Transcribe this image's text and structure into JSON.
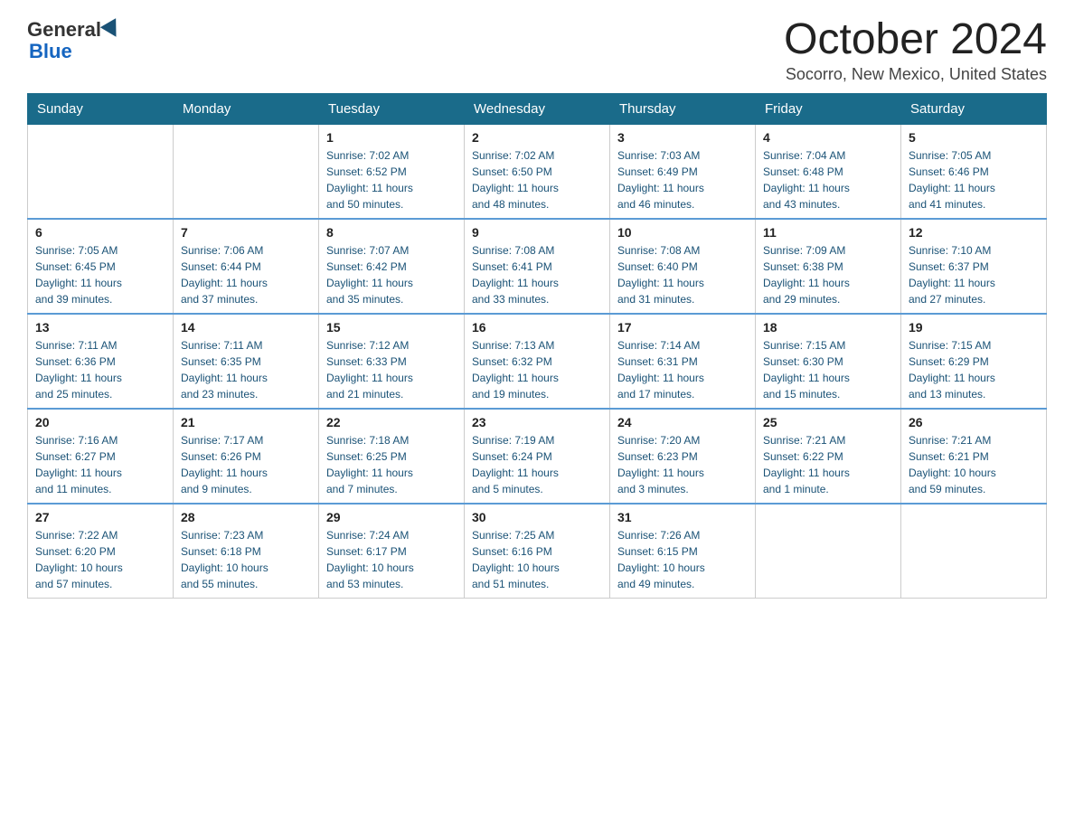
{
  "logo": {
    "general": "General",
    "blue": "Blue"
  },
  "header": {
    "month": "October 2024",
    "location": "Socorro, New Mexico, United States"
  },
  "weekdays": [
    "Sunday",
    "Monday",
    "Tuesday",
    "Wednesday",
    "Thursday",
    "Friday",
    "Saturday"
  ],
  "weeks": [
    [
      {
        "day": "",
        "info": ""
      },
      {
        "day": "",
        "info": ""
      },
      {
        "day": "1",
        "info": "Sunrise: 7:02 AM\nSunset: 6:52 PM\nDaylight: 11 hours\nand 50 minutes."
      },
      {
        "day": "2",
        "info": "Sunrise: 7:02 AM\nSunset: 6:50 PM\nDaylight: 11 hours\nand 48 minutes."
      },
      {
        "day": "3",
        "info": "Sunrise: 7:03 AM\nSunset: 6:49 PM\nDaylight: 11 hours\nand 46 minutes."
      },
      {
        "day": "4",
        "info": "Sunrise: 7:04 AM\nSunset: 6:48 PM\nDaylight: 11 hours\nand 43 minutes."
      },
      {
        "day": "5",
        "info": "Sunrise: 7:05 AM\nSunset: 6:46 PM\nDaylight: 11 hours\nand 41 minutes."
      }
    ],
    [
      {
        "day": "6",
        "info": "Sunrise: 7:05 AM\nSunset: 6:45 PM\nDaylight: 11 hours\nand 39 minutes."
      },
      {
        "day": "7",
        "info": "Sunrise: 7:06 AM\nSunset: 6:44 PM\nDaylight: 11 hours\nand 37 minutes."
      },
      {
        "day": "8",
        "info": "Sunrise: 7:07 AM\nSunset: 6:42 PM\nDaylight: 11 hours\nand 35 minutes."
      },
      {
        "day": "9",
        "info": "Sunrise: 7:08 AM\nSunset: 6:41 PM\nDaylight: 11 hours\nand 33 minutes."
      },
      {
        "day": "10",
        "info": "Sunrise: 7:08 AM\nSunset: 6:40 PM\nDaylight: 11 hours\nand 31 minutes."
      },
      {
        "day": "11",
        "info": "Sunrise: 7:09 AM\nSunset: 6:38 PM\nDaylight: 11 hours\nand 29 minutes."
      },
      {
        "day": "12",
        "info": "Sunrise: 7:10 AM\nSunset: 6:37 PM\nDaylight: 11 hours\nand 27 minutes."
      }
    ],
    [
      {
        "day": "13",
        "info": "Sunrise: 7:11 AM\nSunset: 6:36 PM\nDaylight: 11 hours\nand 25 minutes."
      },
      {
        "day": "14",
        "info": "Sunrise: 7:11 AM\nSunset: 6:35 PM\nDaylight: 11 hours\nand 23 minutes."
      },
      {
        "day": "15",
        "info": "Sunrise: 7:12 AM\nSunset: 6:33 PM\nDaylight: 11 hours\nand 21 minutes."
      },
      {
        "day": "16",
        "info": "Sunrise: 7:13 AM\nSunset: 6:32 PM\nDaylight: 11 hours\nand 19 minutes."
      },
      {
        "day": "17",
        "info": "Sunrise: 7:14 AM\nSunset: 6:31 PM\nDaylight: 11 hours\nand 17 minutes."
      },
      {
        "day": "18",
        "info": "Sunrise: 7:15 AM\nSunset: 6:30 PM\nDaylight: 11 hours\nand 15 minutes."
      },
      {
        "day": "19",
        "info": "Sunrise: 7:15 AM\nSunset: 6:29 PM\nDaylight: 11 hours\nand 13 minutes."
      }
    ],
    [
      {
        "day": "20",
        "info": "Sunrise: 7:16 AM\nSunset: 6:27 PM\nDaylight: 11 hours\nand 11 minutes."
      },
      {
        "day": "21",
        "info": "Sunrise: 7:17 AM\nSunset: 6:26 PM\nDaylight: 11 hours\nand 9 minutes."
      },
      {
        "day": "22",
        "info": "Sunrise: 7:18 AM\nSunset: 6:25 PM\nDaylight: 11 hours\nand 7 minutes."
      },
      {
        "day": "23",
        "info": "Sunrise: 7:19 AM\nSunset: 6:24 PM\nDaylight: 11 hours\nand 5 minutes."
      },
      {
        "day": "24",
        "info": "Sunrise: 7:20 AM\nSunset: 6:23 PM\nDaylight: 11 hours\nand 3 minutes."
      },
      {
        "day": "25",
        "info": "Sunrise: 7:21 AM\nSunset: 6:22 PM\nDaylight: 11 hours\nand 1 minute."
      },
      {
        "day": "26",
        "info": "Sunrise: 7:21 AM\nSunset: 6:21 PM\nDaylight: 10 hours\nand 59 minutes."
      }
    ],
    [
      {
        "day": "27",
        "info": "Sunrise: 7:22 AM\nSunset: 6:20 PM\nDaylight: 10 hours\nand 57 minutes."
      },
      {
        "day": "28",
        "info": "Sunrise: 7:23 AM\nSunset: 6:18 PM\nDaylight: 10 hours\nand 55 minutes."
      },
      {
        "day": "29",
        "info": "Sunrise: 7:24 AM\nSunset: 6:17 PM\nDaylight: 10 hours\nand 53 minutes."
      },
      {
        "day": "30",
        "info": "Sunrise: 7:25 AM\nSunset: 6:16 PM\nDaylight: 10 hours\nand 51 minutes."
      },
      {
        "day": "31",
        "info": "Sunrise: 7:26 AM\nSunset: 6:15 PM\nDaylight: 10 hours\nand 49 minutes."
      },
      {
        "day": "",
        "info": ""
      },
      {
        "day": "",
        "info": ""
      }
    ]
  ]
}
